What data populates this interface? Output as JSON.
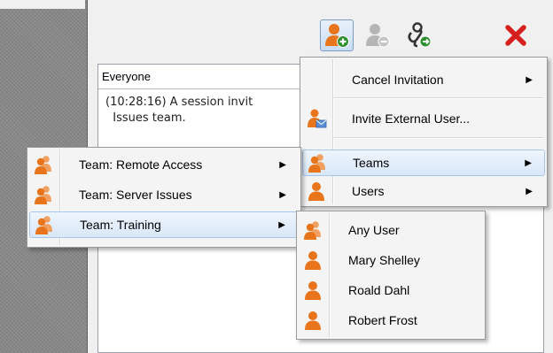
{
  "toolbar": {
    "add_participant": "add-user-icon",
    "remove_participant": "remove-user-icon",
    "link_transfer": "link-icon",
    "close": "close-icon"
  },
  "chat": {
    "header": "Everyone",
    "message_line1": "(10:28:16) A session invit",
    "message_line2": "  Issues team."
  },
  "main_menu": {
    "items": [
      {
        "label": "Cancel Invitation",
        "has_submenu": true
      },
      {
        "label": "Invite External User...",
        "has_submenu": false
      },
      {
        "label": "Teams",
        "has_submenu": true
      },
      {
        "label": "Users",
        "has_submenu": true
      }
    ]
  },
  "teams_menu": {
    "items": [
      {
        "label": "Team: Remote Access"
      },
      {
        "label": "Team: Server Issues"
      },
      {
        "label": "Team: Training"
      }
    ]
  },
  "training_menu": {
    "items": [
      {
        "label": "Any User"
      },
      {
        "label": "Mary Shelley"
      },
      {
        "label": "Roald Dahl"
      },
      {
        "label": "Robert Frost"
      }
    ]
  },
  "arrow_glyph": "▶",
  "colors": {
    "user_orange": "#e8741c",
    "close_red": "#d62020",
    "add_green": "#2f8f2f",
    "highlight": "#d9e7f8"
  }
}
